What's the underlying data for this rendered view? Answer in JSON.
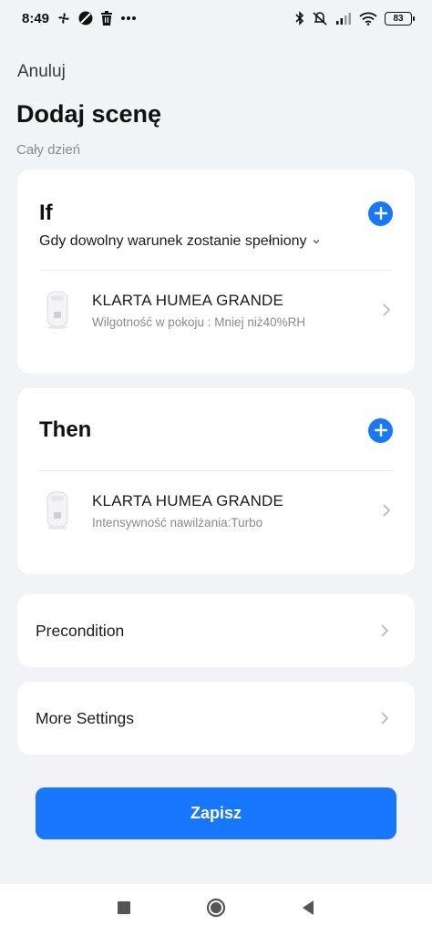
{
  "status_bar": {
    "time": "8:49",
    "left_icons": [
      "fan-icon",
      "restricted-icon",
      "trash-icon",
      "more-dots-icon"
    ],
    "right_icons": [
      "bluetooth-icon",
      "mute-icon",
      "signal-icon",
      "wifi-icon"
    ],
    "battery": "83"
  },
  "header": {
    "cancel_label": "Anuluj",
    "title": "Dodaj scenę",
    "subtitle": "Cały dzień"
  },
  "if_section": {
    "title": "If",
    "condition_mode": "Gdy dowolny warunek zostanie spełniony",
    "device": {
      "name": "KLARTA HUMEA GRANDE",
      "detail": "Wilgotność w pokoju : Mniej niż40%RH"
    }
  },
  "then_section": {
    "title": "Then",
    "device": {
      "name": "KLARTA HUMEA GRANDE",
      "detail": "Intensywność nawilżania:Turbo"
    }
  },
  "precondition": {
    "label": "Precondition"
  },
  "more_settings": {
    "label": "More Settings"
  },
  "save_label": "Zapisz",
  "colors": {
    "accent": "#1778ff",
    "background": "#f2f3f7",
    "card": "#ffffff",
    "secondary_text": "#8a8a8e"
  },
  "nav": [
    "recents-square-icon",
    "home-circle-icon",
    "back-triangle-icon"
  ]
}
